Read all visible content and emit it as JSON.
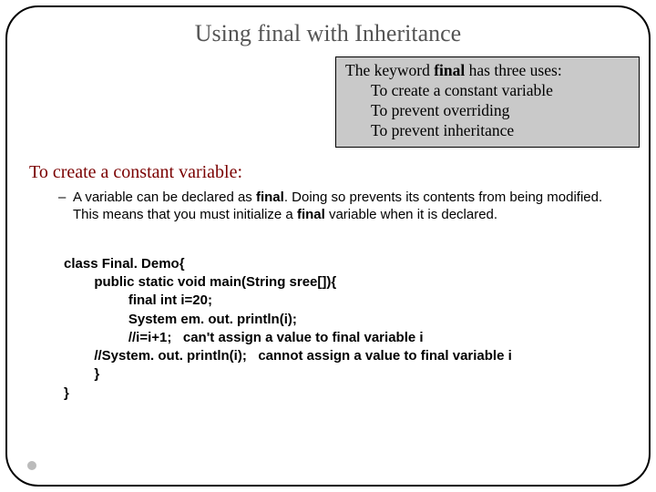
{
  "title": "Using final with Inheritance",
  "callout": {
    "intro_pre": "The keyword ",
    "intro_kw": "final",
    "intro_post": " has three uses:",
    "u1": "To create a constant variable",
    "u2": "To prevent overriding",
    "u3": "To prevent inheritance"
  },
  "section": "To create a constant variable:",
  "bullet": {
    "dash": "–",
    "p1": "A variable can be declared as ",
    "kw1": "final",
    "p2": ". Doing so prevents its contents from being modified. This means that you must initialize a ",
    "kw2": "final",
    "p3": " variable when it is declared."
  },
  "code": {
    "l1": "class Final. Demo{",
    "l2": "        public static void main(String sree[]){",
    "l3": "                 final int i=20;",
    "l4": "                 System em. out. println(i);",
    "l5": "                 //i=i+1;   can't assign a value to final variable i",
    "l6": "        //System. out. println(i);   cannot assign a value to final variable i",
    "l7": "        }",
    "l8": "}"
  }
}
